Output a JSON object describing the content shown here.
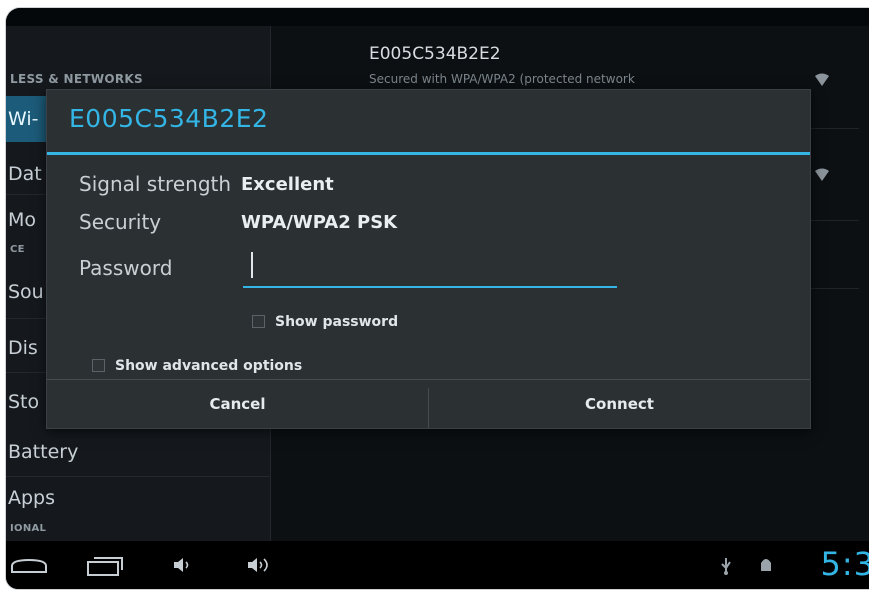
{
  "left_pane": {
    "categories": [
      "LESS & NETWORKS",
      "CE",
      "IONAL"
    ],
    "items": [
      "Wi-",
      "Dat",
      "Mo",
      "Sou",
      "Dis",
      "Sto",
      "Battery",
      "Apps"
    ]
  },
  "networks": [
    {
      "name": "E005C534B2E2",
      "sub": "Secured with WPA/WPA2 (protected network"
    }
  ],
  "dialog": {
    "title": "E005C534B2E2",
    "signal_label": "Signal strength",
    "signal_value": "Excellent",
    "security_label": "Security",
    "security_value": "WPA/WPA2 PSK",
    "password_label": "Password",
    "password_value": "",
    "show_password": "Show password",
    "show_advanced": "Show advanced options",
    "cancel": "Cancel",
    "connect": "Connect"
  },
  "navbar": {
    "clock": "5:3",
    "icons": [
      "back-icon",
      "home-icon",
      "recent-apps-icon",
      "volume-down-icon",
      "volume-up-icon",
      "usb-icon",
      "android-debug-icon"
    ]
  },
  "colors": {
    "accent": "#33b5e5",
    "dialog": "#2b3033",
    "background": "#0f1418"
  }
}
